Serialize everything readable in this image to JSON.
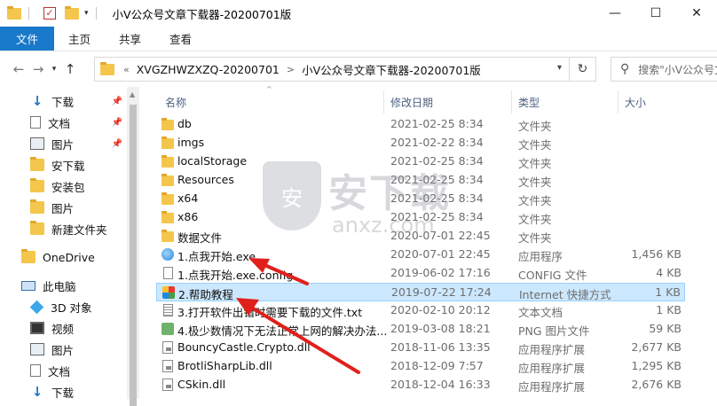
{
  "titlebar": {
    "title": "小V公众号文章下载器-20200701版",
    "minimize": "—",
    "maximize": "☐",
    "close": "✕"
  },
  "ribbon": {
    "tabs": [
      "文件",
      "主页",
      "共享",
      "查看"
    ]
  },
  "address": {
    "prefix": "«",
    "crumbs": [
      "XVGZHWZXZQ-20200701",
      "小V公众号文章下载器-20200701版"
    ],
    "search_placeholder": "搜索\"小V公众号文..."
  },
  "nav": {
    "items": [
      {
        "label": "下载",
        "icon": "download-icon",
        "pinned": true
      },
      {
        "label": "文档",
        "icon": "document-icon",
        "pinned": true
      },
      {
        "label": "图片",
        "icon": "picture-icon",
        "pinned": true
      },
      {
        "label": "安下载",
        "icon": "folder-icon",
        "pinned": false
      },
      {
        "label": "安装包",
        "icon": "folder-icon",
        "pinned": false
      },
      {
        "label": "图片",
        "icon": "folder-icon",
        "pinned": false
      },
      {
        "label": "新建文件夹",
        "icon": "folder-icon",
        "pinned": false
      },
      {
        "label": "OneDrive",
        "icon": "onedrive-icon",
        "pinned": false
      },
      {
        "label": "此电脑",
        "icon": "computer-icon",
        "pinned": false
      },
      {
        "label": "3D 对象",
        "icon": "cube-icon",
        "pinned": false
      },
      {
        "label": "视频",
        "icon": "video-icon",
        "pinned": false
      },
      {
        "label": "图片",
        "icon": "picture-icon",
        "pinned": false
      },
      {
        "label": "文档",
        "icon": "document-icon",
        "pinned": false
      },
      {
        "label": "下载",
        "icon": "download-icon",
        "pinned": false
      }
    ]
  },
  "columns": {
    "name": "名称",
    "date": "修改日期",
    "type": "类型",
    "size": "大小"
  },
  "files": [
    {
      "name": "db",
      "date": "2021-02-25 8:34",
      "type": "文件夹",
      "size": "",
      "kind": "folder"
    },
    {
      "name": "imgs",
      "date": "2021-02-22 8:34",
      "type": "文件夹",
      "size": "",
      "kind": "folder"
    },
    {
      "name": "localStorage",
      "date": "2021-02-25 8:34",
      "type": "文件夹",
      "size": "",
      "kind": "folder"
    },
    {
      "name": "Resources",
      "date": "2021-02-25 8:34",
      "type": "文件夹",
      "size": "",
      "kind": "folder"
    },
    {
      "name": "x64",
      "date": "2021-02-25 8:34",
      "type": "文件夹",
      "size": "",
      "kind": "folder"
    },
    {
      "name": "x86",
      "date": "2021-02-25 8:34",
      "type": "文件夹",
      "size": "",
      "kind": "folder"
    },
    {
      "name": "数据文件",
      "date": "2020-07-01 22:45",
      "type": "文件夹",
      "size": "",
      "kind": "folder"
    },
    {
      "name": "1.点我开始.exe",
      "date": "2020-07-01 22:45",
      "type": "应用程序",
      "size": "1,456 KB",
      "kind": "exe"
    },
    {
      "name": "1.点我开始.exe.config",
      "date": "2019-06-02 17:16",
      "type": "CONFIG 文件",
      "size": "4 KB",
      "kind": "doc"
    },
    {
      "name": "2.帮助教程",
      "date": "2019-07-22 17:24",
      "type": "Internet 快捷方式",
      "size": "1 KB",
      "kind": "web",
      "selected": true
    },
    {
      "name": "3.打开软件出错时需要下载的文件.txt",
      "date": "2020-02-10 20:12",
      "type": "文本文档",
      "size": "1 KB",
      "kind": "txt"
    },
    {
      "name": "4.极少数情况下无法正常上网的解决办法...",
      "date": "2019-03-08 18:21",
      "type": "PNG 图片文件",
      "size": "59 KB",
      "kind": "png"
    },
    {
      "name": "BouncyCastle.Crypto.dll",
      "date": "2018-11-06 13:35",
      "type": "应用程序扩展",
      "size": "2,677 KB",
      "kind": "dll"
    },
    {
      "name": "BrotliSharpLib.dll",
      "date": "2018-12-09 7:57",
      "type": "应用程序扩展",
      "size": "1,295 KB",
      "kind": "dll"
    },
    {
      "name": "CSkin.dll",
      "date": "2018-12-04 16:33",
      "type": "应用程序扩展",
      "size": "2,676 KB",
      "kind": "dll"
    }
  ],
  "watermark": {
    "big": "安下载",
    "small": "anxz.com",
    "shield_char": "安"
  },
  "colors": {
    "accent": "#1979ca",
    "selection": "#cce8ff",
    "arrow": "#e0201b"
  }
}
